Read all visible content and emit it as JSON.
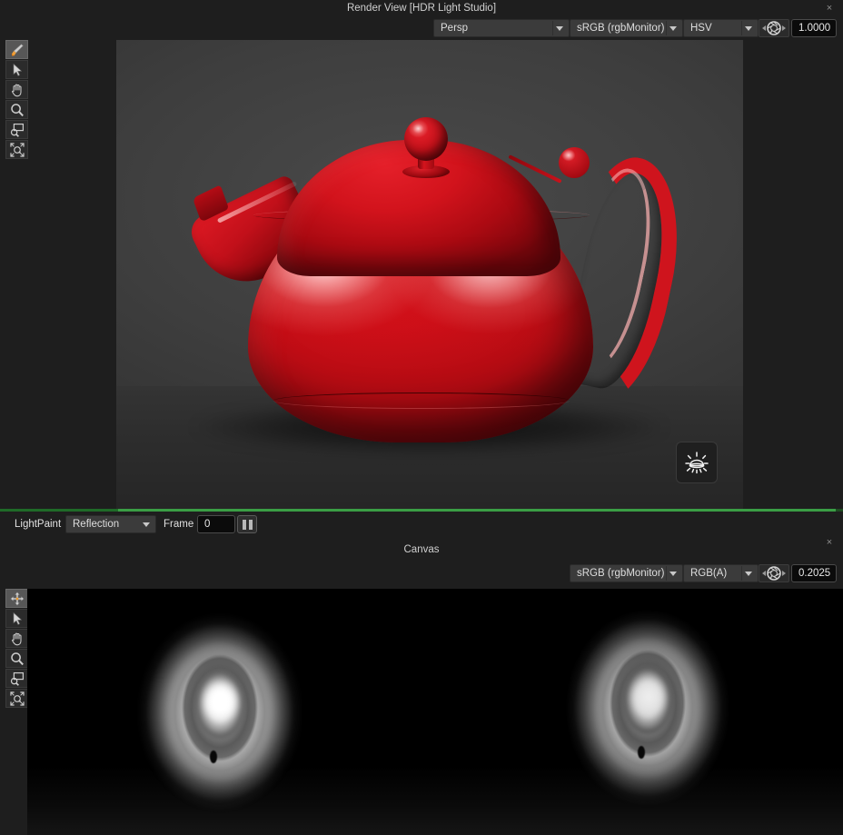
{
  "render_panel": {
    "title": "Render View [HDR Light Studio]",
    "close_label": "×",
    "toolbar": [
      {
        "name": "lightpaint-brush-tool",
        "icon": "brush-icon",
        "active": true
      },
      {
        "name": "select-tool",
        "icon": "arrow-icon",
        "active": false
      },
      {
        "name": "pan-tool",
        "icon": "hand-icon",
        "active": false
      },
      {
        "name": "zoom-tool",
        "icon": "magnifier-icon",
        "active": false
      },
      {
        "name": "zoom-region-tool",
        "icon": "zoom-region-icon",
        "active": false
      },
      {
        "name": "zoom-fit-tool",
        "icon": "zoom-fit-icon",
        "active": false
      }
    ],
    "camera_select": "Persp",
    "colorspace_select": "sRGB (rgbMonitor)",
    "channel_select": "HSV",
    "exposure_icon": "aperture-icon",
    "exposure_value": "1.0000",
    "light_button_icon": "sun-light-icon",
    "progress_percent": 100
  },
  "lightpaint_bar": {
    "mode_label": "LightPaint",
    "mode_value": "Reflection",
    "frame_label": "Frame",
    "frame_value": "0",
    "pause_icon": "pause-icon"
  },
  "canvas_panel": {
    "title": "Canvas",
    "close_label": "×",
    "toolbar": [
      {
        "name": "move-tool",
        "icon": "move-icon",
        "active": true
      },
      {
        "name": "select-tool",
        "icon": "arrow-icon",
        "active": false
      },
      {
        "name": "pan-tool",
        "icon": "hand-icon",
        "active": false
      },
      {
        "name": "zoom-tool",
        "icon": "magnifier-icon",
        "active": false
      },
      {
        "name": "zoom-region-tool",
        "icon": "zoom-region-icon",
        "active": false
      },
      {
        "name": "zoom-fit-tool",
        "icon": "zoom-fit-icon",
        "active": false
      }
    ],
    "colorspace_select": "sRGB (rgbMonitor)",
    "channel_select": "RGB(A)",
    "exposure_icon": "aperture-icon",
    "exposure_value": "0.2025"
  },
  "colors": {
    "panel_bg": "#1e1e1e",
    "progress_green": "#2f8f3a",
    "teapot_red": "#cf0f18",
    "render_bg": "#3a3a3a",
    "canvas_bg": "#000000"
  }
}
